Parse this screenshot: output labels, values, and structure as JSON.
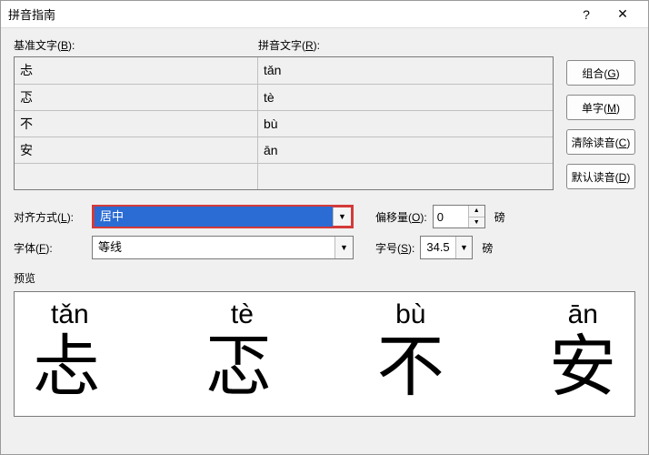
{
  "window": {
    "title": "拼音指南",
    "help": "?",
    "close": "✕"
  },
  "labels": {
    "baseText": "基准文字(B):",
    "rubyText": "拼音文字(R):",
    "alignment": "对齐方式(L):",
    "offset": "偏移量(O):",
    "font": "字体(F):",
    "size": "字号(S):",
    "preview": "预览",
    "unitPoint": "磅"
  },
  "rows": [
    {
      "base": "忐",
      "ruby": "tǎn"
    },
    {
      "base": "忑",
      "ruby": "tè"
    },
    {
      "base": "不",
      "ruby": "bù"
    },
    {
      "base": "安",
      "ruby": "ān"
    },
    {
      "base": "",
      "ruby": ""
    }
  ],
  "buttons": {
    "group": "组合(G)",
    "mono": "单字(M)",
    "clear": "清除读音(C)",
    "default": "默认读音(D)"
  },
  "fields": {
    "alignment": "居中",
    "offset": "0",
    "font": "等线",
    "size": "34.5"
  },
  "preview": {
    "ruby": [
      "tǎn",
      "tè",
      "bù",
      "ān"
    ],
    "base": [
      "忐",
      "忑",
      "不",
      "安"
    ]
  }
}
